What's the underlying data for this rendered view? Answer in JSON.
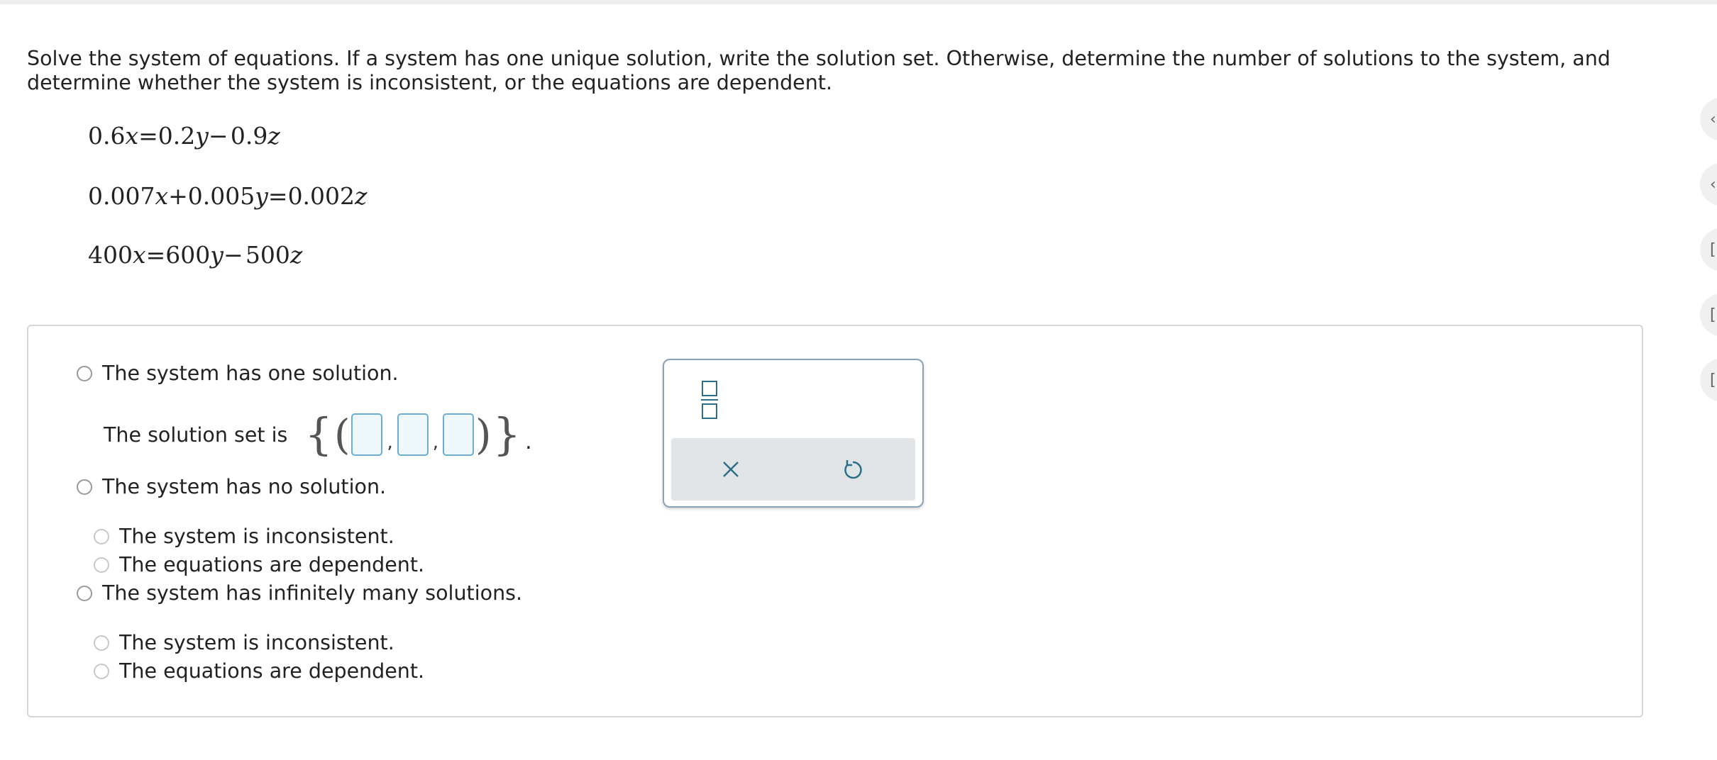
{
  "prompt": "Solve the system of equations. If a system has one unique solution, write the solution set. Otherwise, determine the number of solutions to the system, and determine whether the system is inconsistent, or the equations are dependent.",
  "equations": {
    "eq1": {
      "a": "0.6",
      "v1": "x",
      "eq": "=",
      "b": "0.2",
      "v2": "y",
      "op": "−",
      "c": "0.9",
      "v3": "z"
    },
    "eq2": {
      "a": "0.007",
      "v1": "x",
      "op": "+",
      "b": "0.005",
      "v2": "y",
      "eq": "=",
      "c": "0.002",
      "v3": "z"
    },
    "eq3": {
      "a": "400",
      "v1": "x",
      "eq": "=",
      "b": "600",
      "v2": "y",
      "op": "−",
      "c": "500",
      "v3": "z"
    }
  },
  "options": {
    "one_solution": "The system has one solution.",
    "solution_set_label": "The solution set is",
    "no_solution": "The system has no solution.",
    "no_inconsistent": "The system is inconsistent.",
    "no_dependent": "The equations are dependent.",
    "infinite": "The system has infinitely many solutions.",
    "inf_inconsistent": "The system is inconsistent.",
    "inf_dependent": "The equations are dependent."
  },
  "solution_set": {
    "open_brace": "{",
    "open_paren": "(",
    "comma": ",",
    "close_paren": ")",
    "close_brace": "}",
    "period": "."
  },
  "palette": {
    "icons": [
      "fraction-icon",
      "close-icon",
      "undo-icon"
    ]
  },
  "colors": {
    "blank_border": "#6aaed6",
    "blank_fill": "#eef7fc",
    "palette_border": "#8aa3b3",
    "palette_bar": "#e1e4e6",
    "icon_teal": "#2a6f88"
  }
}
